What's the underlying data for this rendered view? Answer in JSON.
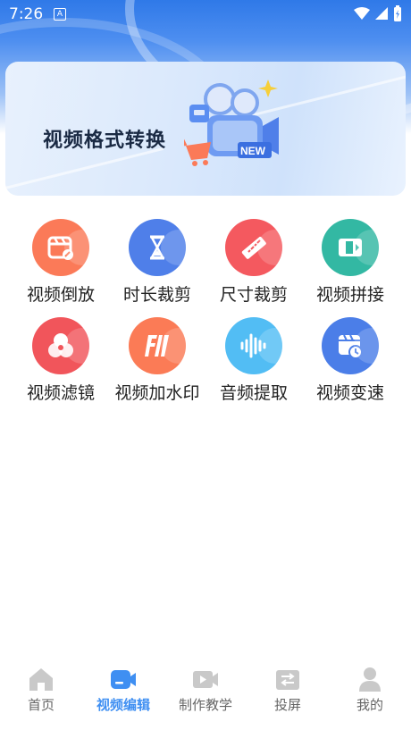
{
  "status_bar": {
    "time": "7:26",
    "notification_badge": "A"
  },
  "banner": {
    "title": "视频格式转换",
    "badge_text": "NEW"
  },
  "tools": [
    {
      "label": "视频倒放",
      "icon": "video-reverse-icon",
      "color": "#fb7a58"
    },
    {
      "label": "时长裁剪",
      "icon": "hourglass-icon",
      "color": "#4f7fe9"
    },
    {
      "label": "尺寸裁剪",
      "icon": "ruler-icon",
      "color": "#f4595f"
    },
    {
      "label": "视频拼接",
      "icon": "video-splice-icon",
      "color": "#33b8a3"
    },
    {
      "label": "视频滤镜",
      "icon": "filter-icon",
      "color": "#f1555b"
    },
    {
      "label": "视频加水印",
      "icon": "watermark-icon",
      "color": "#fb7b56"
    },
    {
      "label": "音频提取",
      "icon": "audio-wave-icon",
      "color": "#52bdf4"
    },
    {
      "label": "视频变速",
      "icon": "speed-clock-icon",
      "color": "#4b7ee8"
    }
  ],
  "tabbar": {
    "active_color": "#3f8ff2",
    "inactive_color": "#c9c9c9",
    "items": [
      {
        "label": "首页",
        "icon": "home-icon"
      },
      {
        "label": "视频编辑",
        "icon": "video-camera-icon"
      },
      {
        "label": "制作教学",
        "icon": "tutorial-video-icon"
      },
      {
        "label": "投屏",
        "icon": "screen-cast-icon"
      },
      {
        "label": "我的",
        "icon": "profile-icon"
      }
    ]
  }
}
